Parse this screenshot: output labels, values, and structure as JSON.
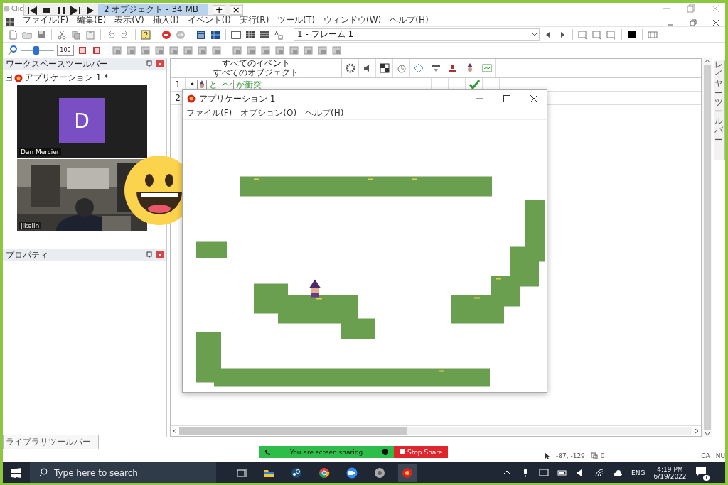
{
  "app_window": {
    "title": "Clic"
  },
  "menu": [
    "ファイル(F)",
    "編集(E)",
    "表示(V)",
    "挿入(I)",
    "イベント(I)",
    "実行(R)",
    "ツール(T)",
    "ウィンドウ(W)",
    "ヘルプ(H)"
  ],
  "frame_selector": {
    "value": "1 - フレーム 1"
  },
  "zoom_slider": {
    "level": 0.45
  },
  "zoom_field": {
    "value": "100"
  },
  "workspace_panel": {
    "title": "ワークスペースツールバー",
    "tree": [
      {
        "label": "アプリケーション 1 *",
        "expanded": true
      }
    ]
  },
  "properties_panel": {
    "title": "プロパティ"
  },
  "event_editor": {
    "header": [
      "すべてのイベント",
      "すべてのオブジェクト"
    ],
    "rows": [
      {
        "number": "1",
        "bullet": "•",
        "words": [
          "と",
          "が衝突"
        ],
        "checked": true
      },
      {
        "number": "2",
        "checked": false
      }
    ]
  },
  "layer_toolbar": {
    "title": "レイヤーツールバー"
  },
  "library_tab": {
    "label": "ライブラリツールバー"
  },
  "status_bar": {
    "coords": "-87, -129",
    "count": "0",
    "keys": [
      "CA",
      "NU"
    ]
  },
  "media_bar": {
    "info": "2 オブジェクト - 34 MB",
    "buttons": [
      "+",
      "×"
    ]
  },
  "participants": [
    {
      "kind": "avatar",
      "initial": "D",
      "name": "Dan Mercier"
    },
    {
      "kind": "video",
      "name": "jikelin"
    }
  ],
  "preview_window": {
    "title": "アプリケーション 1",
    "menu": [
      "ファイル(F)",
      "オプション(O)",
      "ヘルプ(H)"
    ]
  },
  "share_bar": {
    "message": "You are screen sharing",
    "stop": "Stop Share"
  },
  "taskbar": {
    "search_placeholder": "Type here to search",
    "language": "ENG",
    "time": "4:19 PM",
    "date": "6/19/2022",
    "notifications": "1"
  }
}
